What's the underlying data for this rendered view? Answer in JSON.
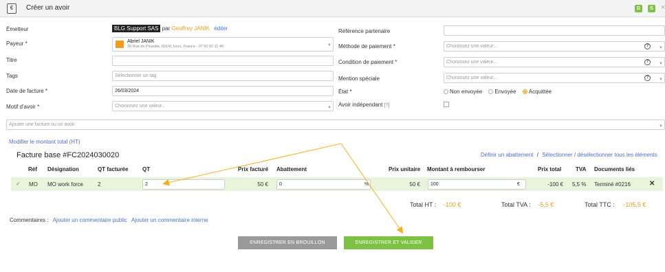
{
  "header": {
    "title": "Créer un avoir",
    "badges": [
      {
        "label": "D",
        "color": "#7dc242"
      },
      {
        "label": "S",
        "color": "#7dc242"
      }
    ],
    "close": "×"
  },
  "form": {
    "emetteur": {
      "label": "Émetteur",
      "company": "BLG Support SAS",
      "par": "par",
      "user": "Geoffrey JANIK",
      "edit": "éditer"
    },
    "payeur": {
      "label": "Payeur *",
      "name": "Abriel JANIK",
      "address": "30 Rue de Picardie, 60141 Ivors, France - 07 50 92 11 40"
    },
    "titre": {
      "label": "Titre",
      "value": ""
    },
    "tags": {
      "label": "Tags",
      "placeholder": "Sélectionner un tag"
    },
    "date": {
      "label": "Date de facture *",
      "value": "26/03/2024"
    },
    "motif": {
      "label": "Motif d'avoir *",
      "placeholder": "Choisissez une valeur..."
    },
    "reference": {
      "label": "Référence partenaire",
      "value": ""
    },
    "methode": {
      "label": "Méthode de paiement *",
      "placeholder": "Choisissez une valeur..."
    },
    "condition": {
      "label": "Condition de paiement *",
      "placeholder": "Choisissez une valeur..."
    },
    "mention": {
      "label": "Mention spéciale",
      "placeholder": "Choisissez une valeur..."
    },
    "etat": {
      "label": "État *",
      "options": [
        "Non envoyée",
        "Envoyée",
        "Acquittée"
      ],
      "selected": "Acquittée"
    },
    "independant": {
      "label": "Avoir indépendant",
      "help": "[?]"
    },
    "add_invoice": {
      "placeholder": "Ajouter une facture ou un avoir"
    }
  },
  "invoice": {
    "modify_link": "Modifier le montant total (HT)",
    "title": "Facture base #FC2024030020",
    "actions": {
      "abatement": "Définir un abattement",
      "separator": "/",
      "select": "Sélectionner / désélectionner tous les éléments"
    },
    "columns": [
      "Réf",
      "Désignation",
      "QT facturée",
      "QT",
      "Prix facturé",
      "Abattement",
      "Prix unitaire",
      "Montant à rembourser",
      "Prix total",
      "TVA",
      "Documents liés"
    ],
    "rows": [
      {
        "check": "✓",
        "ref": "MO",
        "designation": "MO work force",
        "qt_facturee": "2",
        "qt": "2",
        "prix_facture": "50 €",
        "abattement": "0",
        "abattement_unit": "%",
        "prix_unitaire": "50 €",
        "montant": "100",
        "montant_unit": "€",
        "prix_total": "-100 €",
        "tva": "5,5 %",
        "document": "Terminé #0216",
        "remove": "✕"
      }
    ],
    "totals": {
      "ht_label": "Total HT :",
      "ht_value": "-100 €",
      "tva_label": "Total TVA :",
      "tva_value": "-5,5 €",
      "ttc_label": "Total TTC :",
      "ttc_value": "-105,5 €"
    }
  },
  "comments": {
    "label": "Commentaires :",
    "public": "Ajouter un commentaire public",
    "internal": "Ajouter un commentaire interne"
  },
  "buttons": {
    "draft": "ENREGISTRER EN BROUILLON",
    "validate": "ENREGISTRER ET VALIDER"
  },
  "colors": {
    "accent": "#f29b1d",
    "link": "#4a6fd8",
    "draft_button": "#9a9a9a",
    "validate_button": "#7dc242",
    "row_bg": "#e8f4dc"
  }
}
